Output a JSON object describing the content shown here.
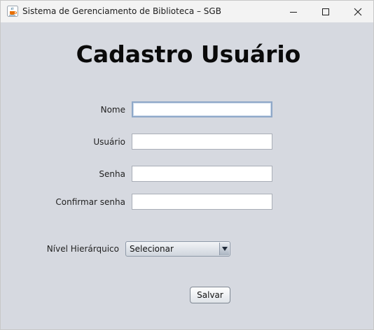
{
  "window": {
    "title": "Sistema de Gerenciamento de Biblioteca – SGB",
    "icon": "java-coffee-icon"
  },
  "form": {
    "title": "Cadastro Usuário",
    "fields": {
      "nome": {
        "label": "Nome",
        "value": ""
      },
      "usuario": {
        "label": "Usuário",
        "value": ""
      },
      "senha": {
        "label": "Senha",
        "value": ""
      },
      "confirmar": {
        "label": "Confirmar senha",
        "value": ""
      }
    },
    "nivel": {
      "label": "Nível Hierárquico",
      "selected": "Selecionar"
    },
    "save_label": "Salvar"
  },
  "colors": {
    "background": "#d6d9e0",
    "titlebar": "#f3f3f3",
    "focus_border": "#8fa8c8"
  }
}
